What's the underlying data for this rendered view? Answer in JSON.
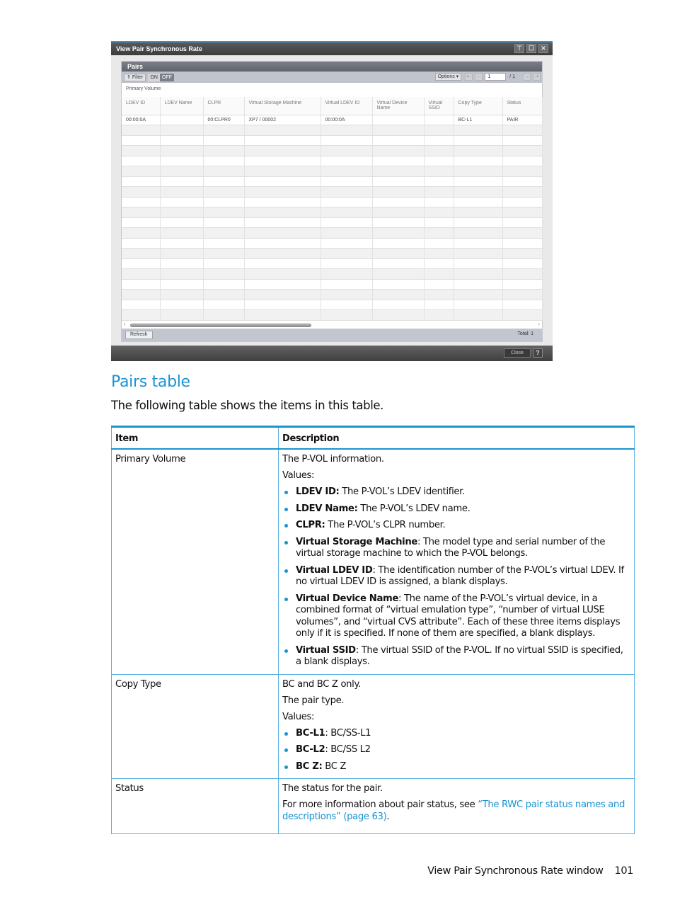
{
  "window": {
    "title": "View Pair Synchronous Rate",
    "controls": [
      "pin-icon",
      "maximize-icon",
      "close-icon"
    ],
    "panel_title": "Pairs",
    "toolbar": {
      "filter_label": "Filter",
      "on_label": "ON",
      "off_label": "OFF",
      "options_label": "Options",
      "page_current": "1",
      "page_total": "/ 1"
    },
    "group_label": "Primary Volume",
    "columns": [
      "LDEV ID",
      "LDEV Name",
      "CLPR",
      "Virtual Storage Machine",
      "Virtual LDEV ID",
      "Virtual Device Name",
      "Virtual SSID",
      "Copy Type",
      "Status"
    ],
    "rows": [
      [
        "00:00:0A",
        "",
        "00:CLPR0",
        "XP7 / 00002",
        "00:00:0A",
        "",
        "",
        "BC-L1",
        "PAIR"
      ]
    ],
    "empty_rows": 19,
    "refresh_label": "Refresh",
    "total_label": "Total:  1",
    "close_label": "Close",
    "help_label": "?"
  },
  "section": {
    "title": "Pairs table",
    "intro": "The following table shows the items in this table."
  },
  "doc_table": {
    "headers": {
      "item": "Item",
      "description": "Description"
    },
    "rows": [
      {
        "item": "Primary Volume",
        "paragraphs": [
          "The P-VOL information.",
          "Values:"
        ],
        "bullets": [
          {
            "term": "LDEV ID:",
            "text": " The P-VOL’s LDEV identifier."
          },
          {
            "term": "LDEV Name:",
            "text": " The P-VOL’s LDEV name."
          },
          {
            "term": "CLPR:",
            "text": " The P-VOL’s CLPR number."
          },
          {
            "term": "Virtual Storage Machine",
            "text": ": The model type and serial number of the virtual storage machine to which the P-VOL belongs."
          },
          {
            "term": "Virtual LDEV ID",
            "text": ": The identification number of the P-VOL’s virtual LDEV. If no virtual LDEV ID is assigned, a blank displays."
          },
          {
            "term": "Virtual Device Name",
            "text": ": The name of the P-VOL’s virtual device, in a combined format of “virtual emulation type”, “number of virtual LUSE volumes”, and “virtual CVS attribute”. Each of these three items displays only if it is specified. If none of them are specified, a blank displays."
          },
          {
            "term": "Virtual SSID",
            "text": ": The virtual SSID of the P-VOL. If no virtual SSID is specified, a blank displays."
          }
        ]
      },
      {
        "item": "Copy Type",
        "paragraphs": [
          "BC and BC Z only.",
          "The pair type.",
          "Values:"
        ],
        "bullets": [
          {
            "term": "BC-L1",
            "text": ": BC/SS-L1"
          },
          {
            "term": "BC-L2",
            "text": ": BC/SS L2"
          },
          {
            "term": "BC Z:",
            "text": " BC Z"
          }
        ]
      },
      {
        "item": "Status",
        "paragraphs": [
          "The status for the pair."
        ],
        "link_para": {
          "prefix": "For more information about pair status, see ",
          "link": "“The RWC pair status names and descriptions” (page 63)",
          "suffix": "."
        }
      }
    ]
  },
  "footer": {
    "text": "View Pair Synchronous Rate window",
    "page": "101"
  },
  "colors": {
    "accent": "#1a93d1",
    "window_title_bar": "#4a4a4a",
    "window_border": "#3a8fd6"
  }
}
